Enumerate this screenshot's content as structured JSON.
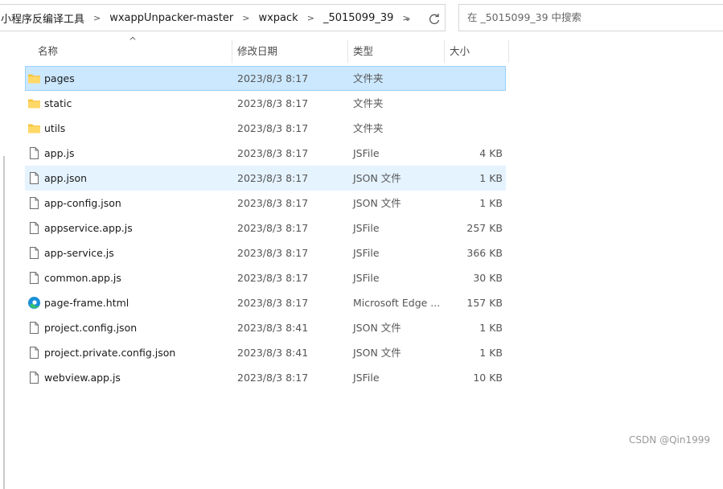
{
  "breadcrumb": [
    "小程序反编译工具",
    "wxappUnpacker-master",
    "wxpack",
    "_5015099_39"
  ],
  "search": {
    "placeholder": "在 _5015099_39 中搜索"
  },
  "columns": {
    "name": "名称",
    "date": "修改日期",
    "type": "类型",
    "size": "大小"
  },
  "files": [
    {
      "name": "pages",
      "date": "2023/8/3 8:17",
      "type": "文件夹",
      "size": "",
      "icon": "folder-icon",
      "state": "selected"
    },
    {
      "name": "static",
      "date": "2023/8/3 8:17",
      "type": "文件夹",
      "size": "",
      "icon": "folder-icon",
      "state": ""
    },
    {
      "name": "utils",
      "date": "2023/8/3 8:17",
      "type": "文件夹",
      "size": "",
      "icon": "folder-icon",
      "state": ""
    },
    {
      "name": "app.js",
      "date": "2023/8/3 8:17",
      "type": "JSFile",
      "size": "4 KB",
      "icon": "file-icon",
      "state": ""
    },
    {
      "name": "app.json",
      "date": "2023/8/3 8:17",
      "type": "JSON 文件",
      "size": "1 KB",
      "icon": "file-icon",
      "state": "hover"
    },
    {
      "name": "app-config.json",
      "date": "2023/8/3 8:17",
      "type": "JSON 文件",
      "size": "1 KB",
      "icon": "file-icon",
      "state": ""
    },
    {
      "name": "appservice.app.js",
      "date": "2023/8/3 8:17",
      "type": "JSFile",
      "size": "257 KB",
      "icon": "file-icon",
      "state": ""
    },
    {
      "name": "app-service.js",
      "date": "2023/8/3 8:17",
      "type": "JSFile",
      "size": "366 KB",
      "icon": "file-icon",
      "state": ""
    },
    {
      "name": "common.app.js",
      "date": "2023/8/3 8:17",
      "type": "JSFile",
      "size": "30 KB",
      "icon": "file-icon",
      "state": ""
    },
    {
      "name": "page-frame.html",
      "date": "2023/8/3 8:17",
      "type": "Microsoft Edge ...",
      "size": "157 KB",
      "icon": "edge-icon",
      "state": ""
    },
    {
      "name": "project.config.json",
      "date": "2023/8/3 8:41",
      "type": "JSON 文件",
      "size": "1 KB",
      "icon": "file-icon",
      "state": ""
    },
    {
      "name": "project.private.config.json",
      "date": "2023/8/3 8:41",
      "type": "JSON 文件",
      "size": "1 KB",
      "icon": "file-icon",
      "state": ""
    },
    {
      "name": "webview.app.js",
      "date": "2023/8/3 8:17",
      "type": "JSFile",
      "size": "10 KB",
      "icon": "file-icon",
      "state": ""
    }
  ],
  "colors": {
    "selected_bg": "#cce8ff",
    "hover_bg": "#e5f3ff",
    "folder": "#f5c440"
  },
  "watermark": "CSDN @Qin1999"
}
